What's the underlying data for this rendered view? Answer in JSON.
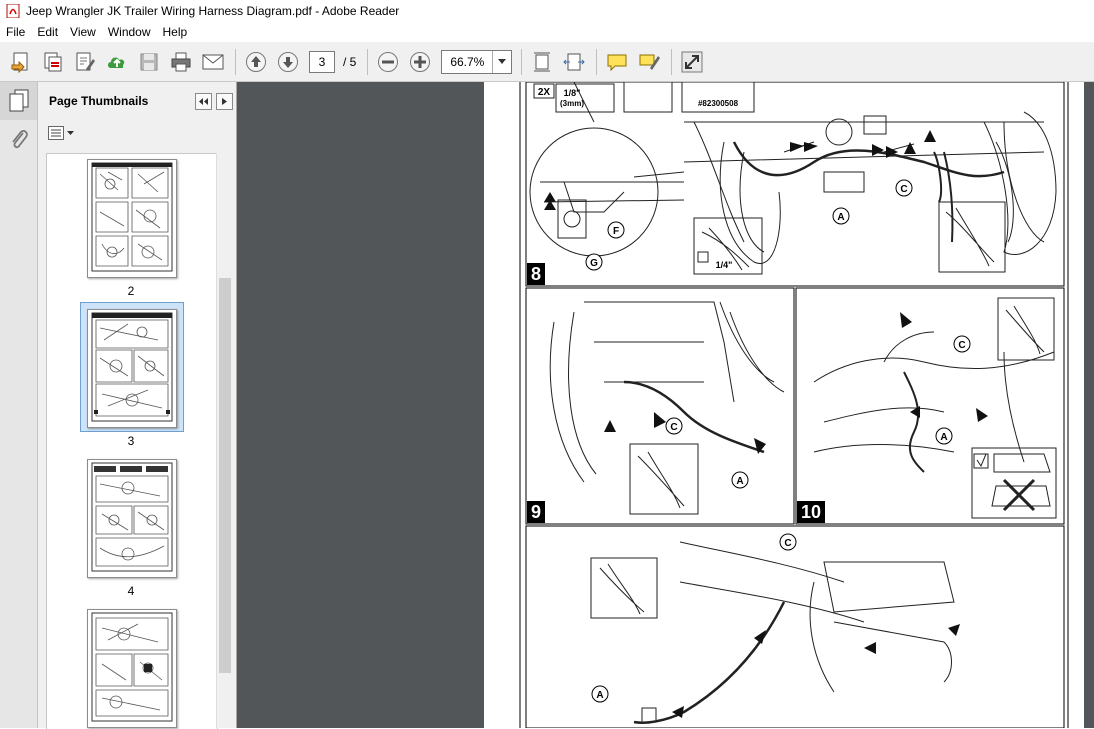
{
  "window": {
    "title": "Jeep Wrangler JK Trailer Wiring Harness Diagram.pdf - Adobe Reader"
  },
  "menu": [
    "File",
    "Edit",
    "View",
    "Window",
    "Help"
  ],
  "toolbar": {
    "current_page": "3",
    "page_of": "/ 5",
    "zoom": "66.7%"
  },
  "nav_panel": {
    "title": "Page Thumbnails",
    "selected_page": "3"
  },
  "thumbnails": [
    {
      "label": "2"
    },
    {
      "label": "3"
    },
    {
      "label": "4"
    },
    {
      "label": ""
    }
  ],
  "document": {
    "panel_numbers": [
      "8",
      "9",
      "10"
    ],
    "callouts": [
      "A",
      "C",
      "F",
      "G"
    ],
    "qty_label": "2X",
    "size_fraction": "1/8\"",
    "size_metric": "(3mm)",
    "socket_size": "1/4\"",
    "part_number": "#82300508"
  },
  "colors": {
    "doc_background": "#525659",
    "toolbar": "#f0f0f0",
    "selection": "#cde3f7"
  }
}
